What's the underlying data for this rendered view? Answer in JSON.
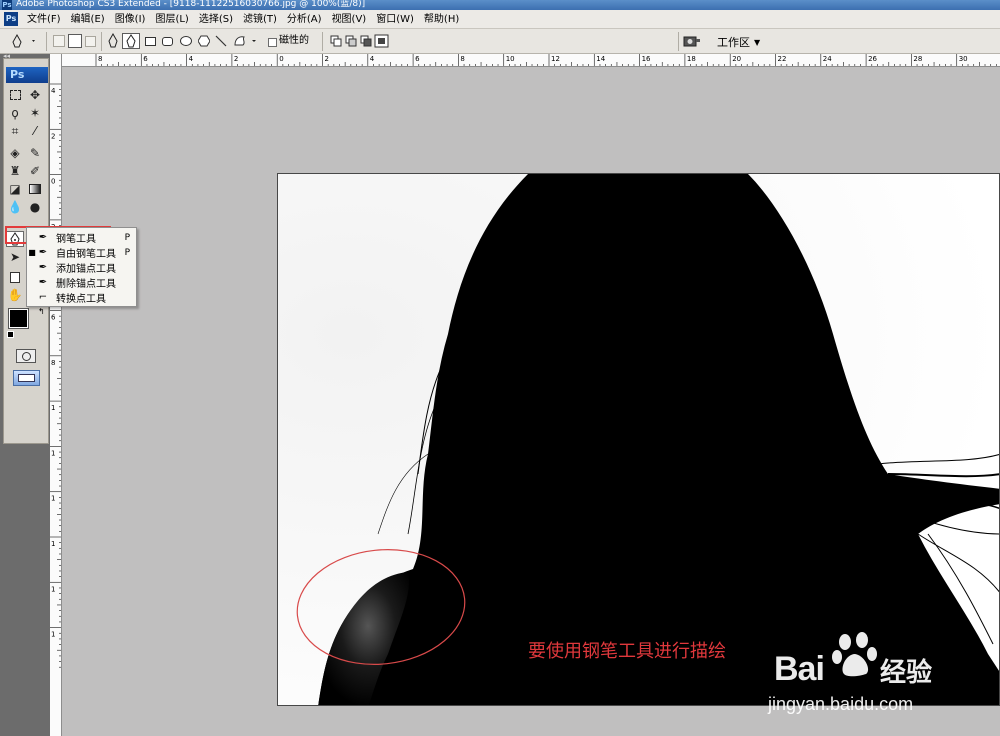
{
  "window": {
    "title": "Adobe Photoshop CS3 Extended - [9118-11122516030766.jpg @ 100%(蓝/8)]"
  },
  "menu": [
    "文件(F)",
    "编辑(E)",
    "图像(I)",
    "图层(L)",
    "选择(S)",
    "滤镜(T)",
    "分析(A)",
    "视图(V)",
    "窗口(W)",
    "帮助(H)"
  ],
  "options_bar": {
    "magnetic_label": "磁性的",
    "workspace_label": "工作区"
  },
  "toolbox": {
    "logo": "Ps"
  },
  "ruler_h_labels": [
    "8",
    "6",
    "4",
    "2",
    "0",
    "2",
    "4",
    "6",
    "8",
    "10",
    "12",
    "14",
    "16",
    "18",
    "20",
    "22",
    "24",
    "26",
    "28",
    "30"
  ],
  "ruler_v_labels": [
    "4",
    "2",
    "0",
    "2",
    "4",
    "6",
    "8",
    "1",
    "1",
    "1",
    "1",
    "1",
    "1"
  ],
  "flyout": {
    "items": [
      {
        "label": "钢笔工具",
        "key": "P",
        "icon": "pen-icon",
        "current": false
      },
      {
        "label": "自由钢笔工具",
        "key": "P",
        "icon": "freeform-pen-icon",
        "current": true
      },
      {
        "label": "添加锚点工具",
        "key": "",
        "icon": "add-anchor-point-icon",
        "current": false
      },
      {
        "label": "删除锚点工具",
        "key": "",
        "icon": "delete-anchor-point-icon",
        "current": false
      },
      {
        "label": "转换点工具",
        "key": "",
        "icon": "convert-point-icon",
        "current": false
      }
    ]
  },
  "annotation": {
    "caption": "要使用钢笔工具进行描绘",
    "highlight_color": "#e33b3b"
  },
  "watermark": {
    "brand": "Bai",
    "brand_cn": "经验",
    "url": "jingyan.baidu.com"
  },
  "colors": {
    "canvas_bg": "#c0bfbf",
    "toolbox_bg": "#6c6c6c",
    "silhouette": "#000000",
    "caption": "#e0383c"
  }
}
